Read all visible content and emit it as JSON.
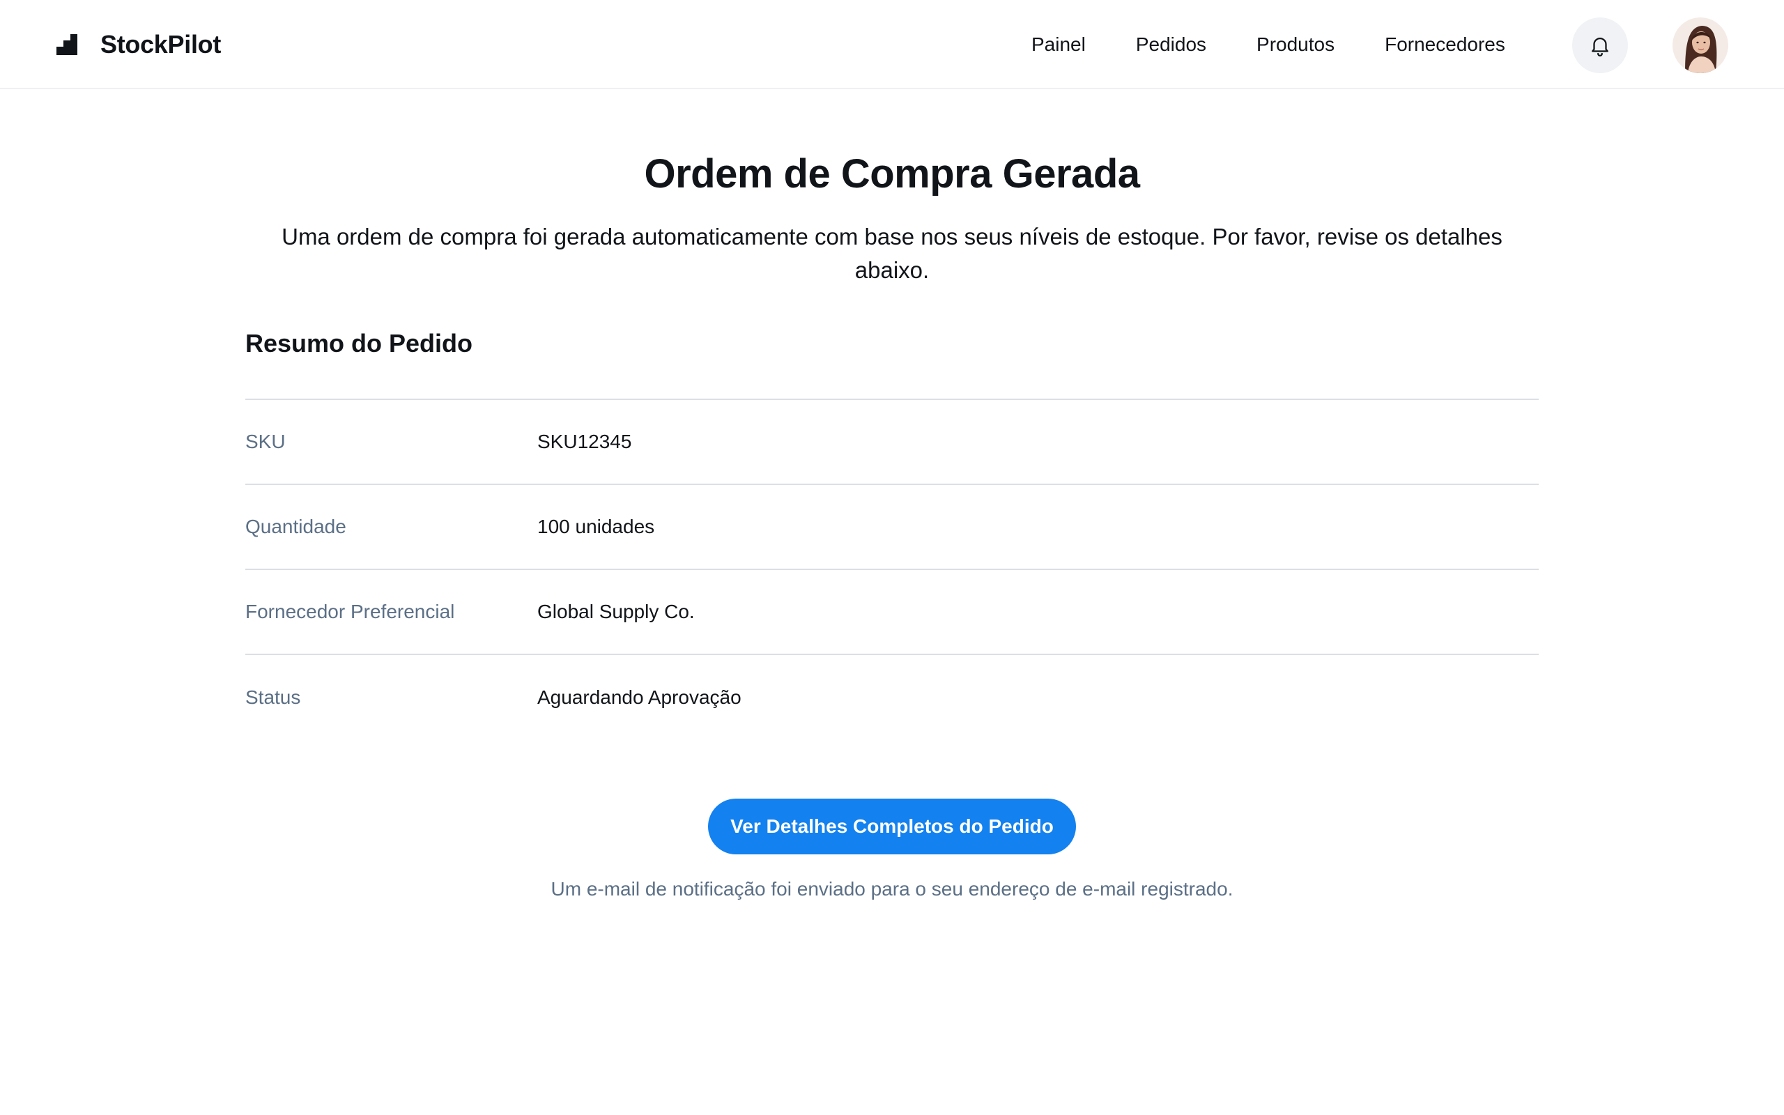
{
  "header": {
    "brand_name": "StockPilot",
    "logo_icon": "bar-steps-icon",
    "nav": [
      {
        "label": "Painel"
      },
      {
        "label": "Pedidos"
      },
      {
        "label": "Produtos"
      },
      {
        "label": "Fornecedores"
      }
    ],
    "notification_icon": "bell-icon",
    "avatar_icon": "user-avatar"
  },
  "main": {
    "title": "Ordem de Compra Gerada",
    "subtitle": "Uma ordem de compra foi gerada automaticamente com base nos seus níveis de estoque. Por favor, revise os detalhes abaixo.",
    "summary_title": "Resumo do Pedido",
    "summary_rows": [
      {
        "label": "SKU",
        "value": "SKU12345"
      },
      {
        "label": "Quantidade",
        "value": "100 unidades"
      },
      {
        "label": "Fornecedor Preferencial",
        "value": "Global Supply Co."
      },
      {
        "label": "Status",
        "value": "Aguardando Aprovação"
      }
    ],
    "primary_button_label": "Ver Detalhes Completos do Pedido",
    "notice": "Um e-mail de notificação foi enviado para o seu endereço de e-mail registrado."
  },
  "colors": {
    "accent": "#1381ef",
    "muted_text": "#5b6f86",
    "divider": "#dcdfe4",
    "text": "#111418"
  }
}
